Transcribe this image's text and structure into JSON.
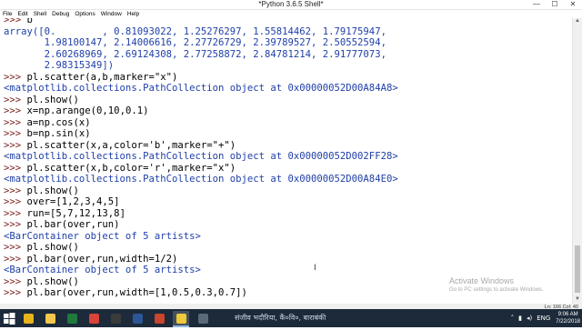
{
  "window": {
    "title": "*Python 3.6.5 Shell*",
    "controls": {
      "minimize": "—",
      "maximize": "☐",
      "close": "✕"
    }
  },
  "menu": [
    "File",
    "Edit",
    "Shell",
    "Debug",
    "Options",
    "Window",
    "Help"
  ],
  "colors": {
    "prompt": "#7a1f1f",
    "code": "#000000",
    "output": "#1f3fa8",
    "string": "#1a8a1a"
  },
  "shell_lines": [
    {
      "kind": "code",
      "text": ">>> b"
    },
    {
      "kind": "output",
      "text": "array([0.        , 0.81093022, 1.25276297, 1.55814462, 1.79175947,"
    },
    {
      "kind": "output",
      "text": "       1.98100147, 2.14006616, 2.27726729, 2.39789527, 2.50552594,"
    },
    {
      "kind": "output",
      "text": "       2.60268969, 2.69124308, 2.77258872, 2.84781214, 2.91777073,"
    },
    {
      "kind": "output",
      "text": "       2.98315349])"
    },
    {
      "kind": "code",
      "text": ">>> pl.scatter(a,b,marker=\"x\")"
    },
    {
      "kind": "output",
      "text": "<matplotlib.collections.PathCollection object at 0x00000052D00A84A8>"
    },
    {
      "kind": "code",
      "text": ">>> pl.show()"
    },
    {
      "kind": "code",
      "text": ">>> x=np.arange(0,10,0.1)"
    },
    {
      "kind": "code",
      "text": ">>> a=np.cos(x)"
    },
    {
      "kind": "code",
      "text": ">>> b=np.sin(x)"
    },
    {
      "kind": "code",
      "text": ">>> pl.scatter(x,a,color='b',marker=\"+\")"
    },
    {
      "kind": "output",
      "text": "<matplotlib.collections.PathCollection object at 0x00000052D002FF28>"
    },
    {
      "kind": "code",
      "text": ">>> pl.scatter(x,b,color='r',marker=\"x\")"
    },
    {
      "kind": "output",
      "text": "<matplotlib.collections.PathCollection object at 0x00000052D00A84E0>"
    },
    {
      "kind": "code",
      "text": ">>> pl.show()"
    },
    {
      "kind": "code",
      "text": ">>> over=[1,2,3,4,5]"
    },
    {
      "kind": "code",
      "text": ">>> run=[5,7,12,13,8]"
    },
    {
      "kind": "code",
      "text": ">>> pl.bar(over,run)"
    },
    {
      "kind": "output",
      "text": "<BarContainer object of 5 artists>"
    },
    {
      "kind": "code",
      "text": ">>> pl.show()"
    },
    {
      "kind": "code",
      "text": ">>> pl.bar(over,run,width=1/2)"
    },
    {
      "kind": "output",
      "text": "<BarContainer object of 5 artists>"
    },
    {
      "kind": "code",
      "text": ">>> pl.show()"
    },
    {
      "kind": "code",
      "text": ">>> pl.bar(over,run,width=[1,0.5,0.3,0.7])"
    }
  ],
  "status": {
    "position": "Ln: 166  Col: 40"
  },
  "watermark": {
    "title": "Activate Windows",
    "subtitle": "Go to PC settings to activate Windows."
  },
  "taskbar": {
    "apps": [
      {
        "icon": "chrome-icon",
        "color": "#e8b21a"
      },
      {
        "icon": "file-explorer-icon",
        "color": "#f3c84d"
      },
      {
        "icon": "excel-icon",
        "color": "#1f7a3c"
      },
      {
        "icon": "chrome-icon",
        "color": "#d8433a"
      },
      {
        "icon": "media-player-icon",
        "color": "#3b3b3b"
      },
      {
        "icon": "word-icon",
        "color": "#2b5797"
      },
      {
        "icon": "powerpoint-icon",
        "color": "#c9452b"
      },
      {
        "icon": "python-icon",
        "color": "#f0c93a"
      },
      {
        "icon": "app-icon",
        "color": "#5a6a7a"
      }
    ],
    "text": "संजीव भदौरिया, कैं०वि०, बाराबंकी",
    "tray_lang": "ENG",
    "time": "9:06 AM",
    "date": "7/22/2018"
  }
}
